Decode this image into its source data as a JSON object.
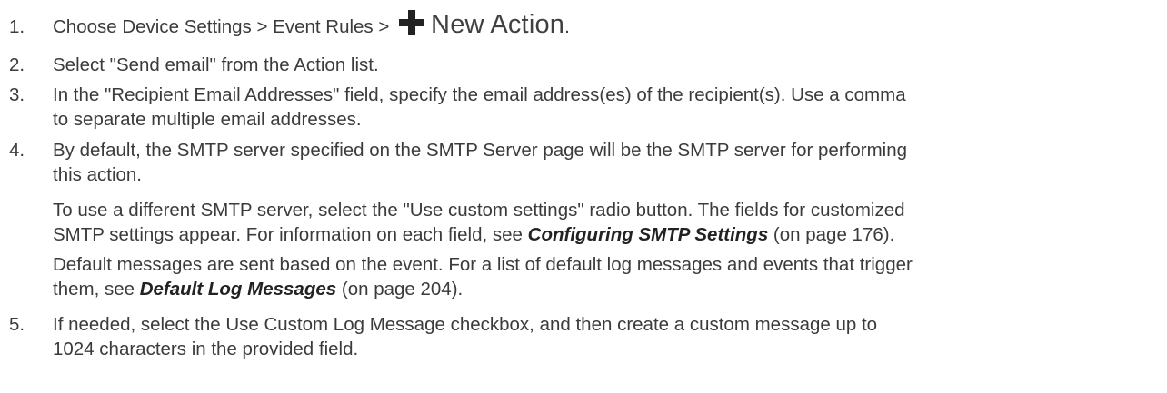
{
  "steps": [
    {
      "num": "1.",
      "text_before": "Choose Device Settings > Event Rules >",
      "button_label": "New Action",
      "text_after": "."
    },
    {
      "num": "2.",
      "text": "Select \"Send email\" from the Action list."
    },
    {
      "num": "3.",
      "line1": "In the \"Recipient Email Addresses\" field, specify the email address(es) of the recipient(s). Use a comma",
      "line2": "to separate multiple email addresses."
    },
    {
      "num": "4.",
      "line1": "By default, the SMTP server specified on the SMTP Server page will be the SMTP server for performing",
      "line2": "this action."
    },
    {
      "num": "5.",
      "line1": "If needed, select the Use Custom Log Message checkbox, and then create a custom message up to",
      "line2": "1024 characters in the provided field."
    }
  ],
  "para_smtp": {
    "line1": "To use a different SMTP server, select the \"Use custom settings\" radio button. The fields for customized",
    "line2_before": "SMTP settings appear. For information on each field, see ",
    "link": "Configuring SMTP Settings",
    "line2_after": " (on page 176)."
  },
  "para_default": {
    "line1": "Default messages are sent based on the event. For a list of default log messages and events that trigger",
    "line2_before": "them, see ",
    "link": "Default Log Messages",
    "line2_after": " (on page 204)."
  },
  "icons": {
    "plus_icon": "plus-icon",
    "plus_color": "#222222"
  }
}
